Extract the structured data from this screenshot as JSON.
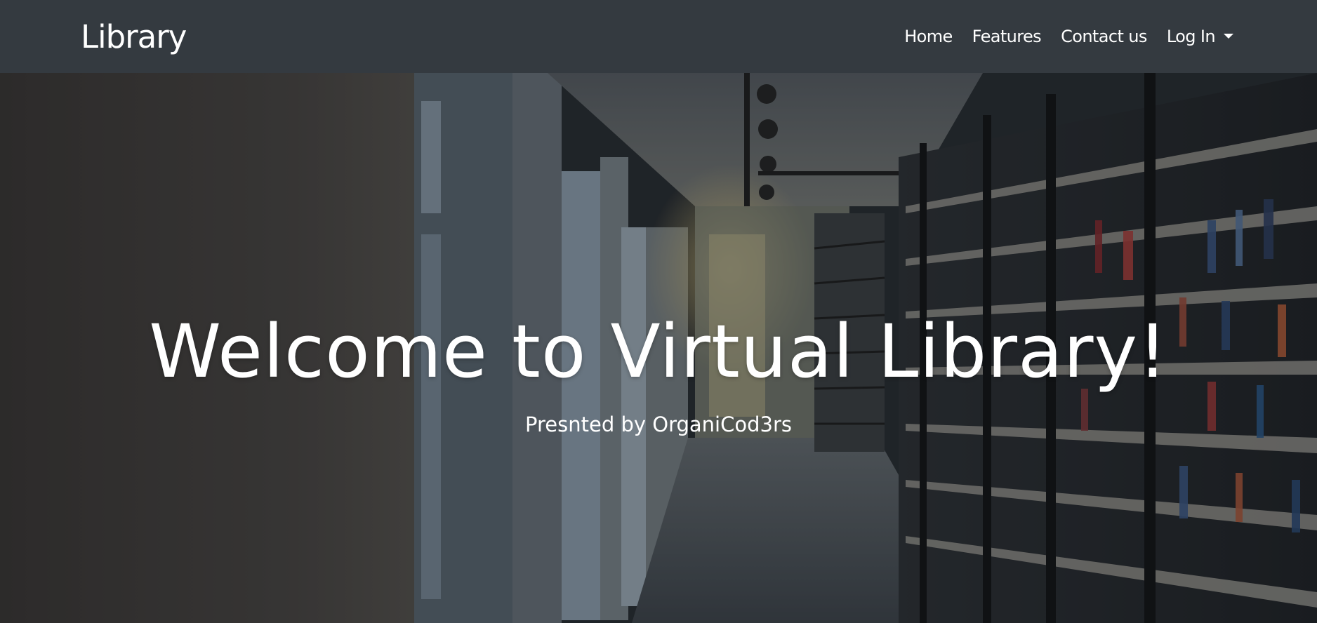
{
  "navbar": {
    "brand": "Library",
    "links": [
      {
        "label": "Home"
      },
      {
        "label": "Features"
      },
      {
        "label": "Contact us"
      },
      {
        "label": "Log In"
      }
    ],
    "background_color": "#343a40"
  },
  "hero": {
    "title": "Welcome to Virtual Library!",
    "subtitle": "Presnted by OrganiCod3rs",
    "background_image": "library-corridor-photo"
  }
}
